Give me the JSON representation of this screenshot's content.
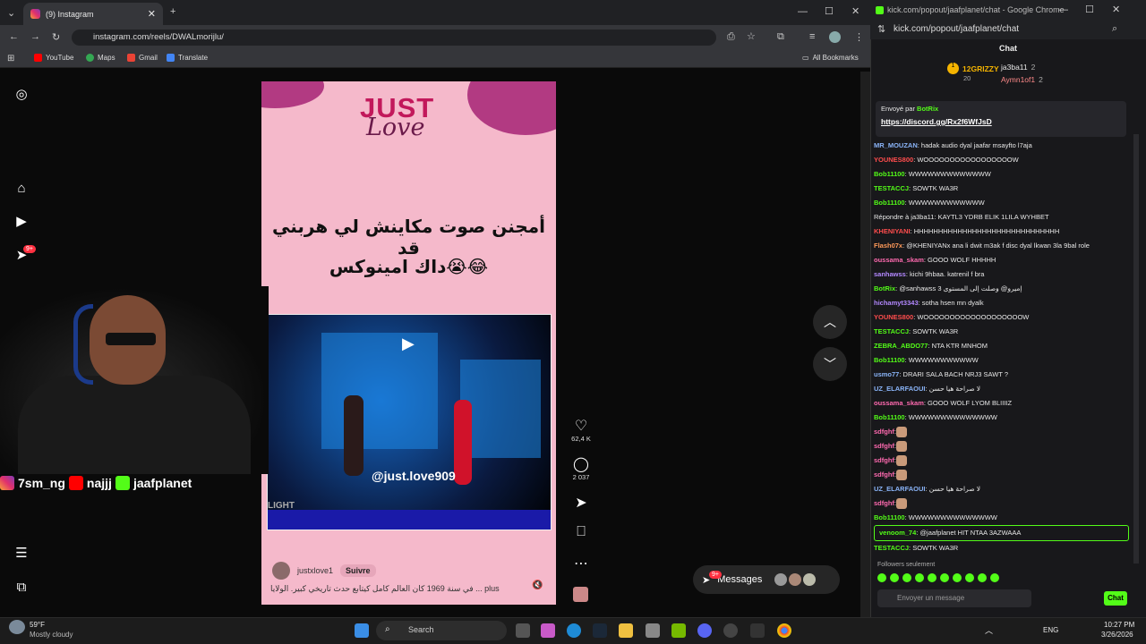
{
  "browser": {
    "tab_title": "(9) Instagram",
    "url": "instagram.com/reels/DWALmorijlu/",
    "bookmarks": [
      "YouTube",
      "Maps",
      "Gmail",
      "Translate"
    ],
    "all_bookmarks": "All Bookmarks"
  },
  "reel": {
    "brand_top": "JUST",
    "brand_script": "Love",
    "line1": "أمجنن صوت مكاينش لي هربني قد",
    "line2": "داك امينوكس😭😂",
    "video_handle": "@just.love909",
    "stage_text": "LIGHT",
    "username": "justxlove1",
    "follow": "Suivre",
    "caption": "في سنة 1969 كان العالم كامل كيتابع حدث تاريخي كبير. الولايا ... plus",
    "likes": "62,4 K",
    "comments": "2 037"
  },
  "ig_sidebar": {
    "badge": "9+"
  },
  "messages": {
    "label": "Messages",
    "badge": "9+"
  },
  "overlay": {
    "insta": "7sm_ng",
    "youtube": "najjj",
    "kick": "jaafplanet"
  },
  "chat_window": {
    "title": "kick.com/popout/jaafplanet/chat - Google Chrome",
    "url": "kick.com/popout/jaafplanet/chat",
    "header": "Chat",
    "gifters": [
      {
        "rank": "1",
        "name": "12GRIZZY",
        "count": "20"
      },
      {
        "name": "ja3ba11",
        "count": "2"
      },
      {
        "name": "Aymn1of1",
        "count": "2"
      }
    ],
    "pinned": {
      "by": "Envoyé par",
      "bot": "BotRix",
      "link": "https://discord.gg/Rx2f6WfJsD"
    },
    "messages": [
      {
        "user": "MR_MOUZAN",
        "color": "#8ab4f8",
        "text": ": hadak audio dyal jaafar msayfto l7aja"
      },
      {
        "user": "YOUNES800",
        "color": "#ff4d4d",
        "text": ": WOOOOOOOOOOOOOOOOOW"
      },
      {
        "user": "Bob11100",
        "color": "#53fc18",
        "text": ": WWWWWWWWWWWWW"
      },
      {
        "user": "TESTACCJ",
        "color": "#53fc18",
        "text": ": SOWTK WA3R"
      },
      {
        "user": "Bob11100",
        "color": "#53fc18",
        "text": ": WWWWWWWWWWWW"
      },
      {
        "user": "",
        "color": "#888",
        "text": "Répondre à ja3ba11: KAYTL3 YDRB ELIK 1LILA WYHBET"
      },
      {
        "user": "KHENIYANI",
        "color": "#ff4d4d",
        "text": ": HHHHHHHHHHHHHHHHHHHHHHHHHHHHHH"
      },
      {
        "user": "Flash07x",
        "color": "#ff9a5a",
        "text": ": @KHENIYANx ana li dwit m3ak f disc dyal lkwan 3la 9bal role"
      },
      {
        "user": "oussama_skam",
        "color": "#ff6ab0",
        "text": ": GOOO WOLF HHHHH"
      },
      {
        "user": "sanhawss",
        "color": "#b388ff",
        "text": ": kichi 9hbaa. katrenil f bra"
      },
      {
        "user": "BotRix",
        "color": "#53fc18",
        "text": ": @sanhawss 3 إميرو@ وصلت إلى المستوى"
      },
      {
        "user": "hichamyt3343",
        "color": "#b388ff",
        "text": ": sotha hsen mn dyalk"
      },
      {
        "user": "YOUNES800",
        "color": "#ff4d4d",
        "text": ": WOOOOOOOOOOOOOOOOOOOW"
      },
      {
        "user": "TESTACCJ",
        "color": "#53fc18",
        "text": ": SOWTK WA3R"
      },
      {
        "user": "ZEBRA_ABDO77",
        "color": "#53fc18",
        "text": ": NTA KTR MNHOM"
      },
      {
        "user": "Bob11100",
        "color": "#53fc18",
        "text": ": WWWWWWWWWWW"
      },
      {
        "user": "usmo77",
        "color": "#8ab4f8",
        "text": ": DRARI SALA BACH NRJ3 SAWT ?"
      },
      {
        "user": "UZ_ELARFAOUI",
        "color": "#8ab4f8",
        "text": ": لا صراحة هيا حسن"
      },
      {
        "user": "oussama_skam",
        "color": "#ff6ab0",
        "text": ": GOOO WOLF LYOM BLIIIIZ"
      },
      {
        "user": "Bob11100",
        "color": "#53fc18",
        "text": ": WWWWWWWWWWWWWW"
      },
      {
        "user": "sdfghf",
        "color": "#ff6ab0",
        "text": ":",
        "emote": true
      },
      {
        "user": "sdfghf",
        "color": "#ff6ab0",
        "text": ":",
        "emote": true
      },
      {
        "user": "sdfghf",
        "color": "#ff6ab0",
        "text": ":",
        "emote": true
      },
      {
        "user": "sdfghf",
        "color": "#ff6ab0",
        "text": ":",
        "emote": true
      },
      {
        "user": "UZ_ELARFAOUI",
        "color": "#8ab4f8",
        "text": ": لا صراحة هيا حسن"
      },
      {
        "user": "sdfghf",
        "color": "#ff6ab0",
        "text": ":",
        "emote": true
      },
      {
        "user": "Bob11100",
        "color": "#53fc18",
        "text": ": WWWWWWWWWWWWWW"
      },
      {
        "user": "venoom_74",
        "color": "#53fc18",
        "text": ": @jaafplanet HIT NTAA 3AZWAAA",
        "highlight": true
      },
      {
        "user": "TESTACCJ",
        "color": "#53fc18",
        "text": ": SOWTK WA3R"
      }
    ],
    "followers_only": "Followers seulement",
    "input_placeholder": "Envoyer un message",
    "chat_button": "Chat"
  },
  "taskbar": {
    "temp": "59°F",
    "weather": "Mostly cloudy",
    "search": "Search",
    "lang": "ENG",
    "time": "10:27 PM",
    "date": "3/26/2026"
  }
}
